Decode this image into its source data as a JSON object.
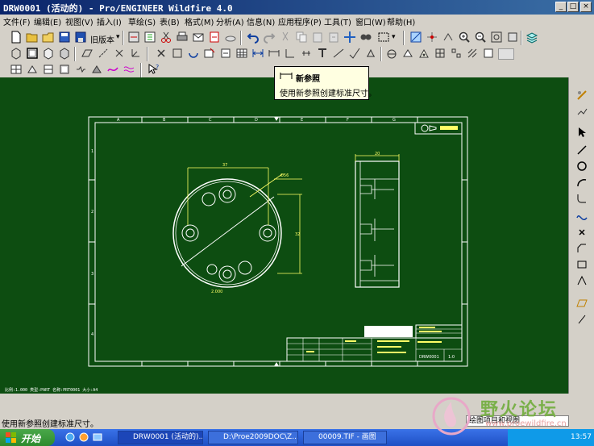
{
  "window": {
    "title": "DRW0001 (活动的) - Pro/ENGINEER Wildfire 4.0",
    "controls": [
      "_",
      "□",
      "×"
    ]
  },
  "menu": [
    "文件(F)",
    "编辑(E)",
    "视图(V)",
    "插入(I)",
    "草绘(S)",
    "表(B)",
    "格式(M)",
    "分析(A)",
    "信息(N)",
    "应用程序(P)",
    "工具(T)",
    "窗口(W)",
    "帮助(H)"
  ],
  "toolbar": {
    "old_version_label": "旧版本"
  },
  "tooltip": {
    "title": "新参照",
    "description": "使用新参照创建标准尺寸。"
  },
  "drawing": {
    "zone_letters": [
      "A",
      "B",
      "C",
      "D",
      "E",
      "F",
      "G",
      "H"
    ],
    "zone_numbers": [
      "1",
      "2",
      "3",
      "4"
    ],
    "dim_diameter": "Ø56",
    "dim_top": "37",
    "dim_right": "32",
    "dim_side": "20",
    "note": "2.000",
    "model_info": "比例:1.000  类型:PART  名称:PRT0001  大小:A4",
    "title_drawing_name": "DRW0001",
    "title_scale": "1:0"
  },
  "status": {
    "message": "使用新参照创建标准尺寸。",
    "filter": "绘图项目和视图"
  },
  "taskbar": {
    "start": "开始",
    "tasks": [
      "DRW0001 (活动的)...",
      "D:\\Proe2009DOC\\Z...",
      "00009.TIF - 画图"
    ],
    "clock": "13:57"
  },
  "watermark": {
    "text": "野火论坛",
    "url": "www.proewildfire.cn"
  },
  "colors": {
    "canvas": "#0d4d11",
    "geometry": "#ffffff",
    "dimension": "#ffff66",
    "tooltip_bg": "#ffffe1"
  }
}
